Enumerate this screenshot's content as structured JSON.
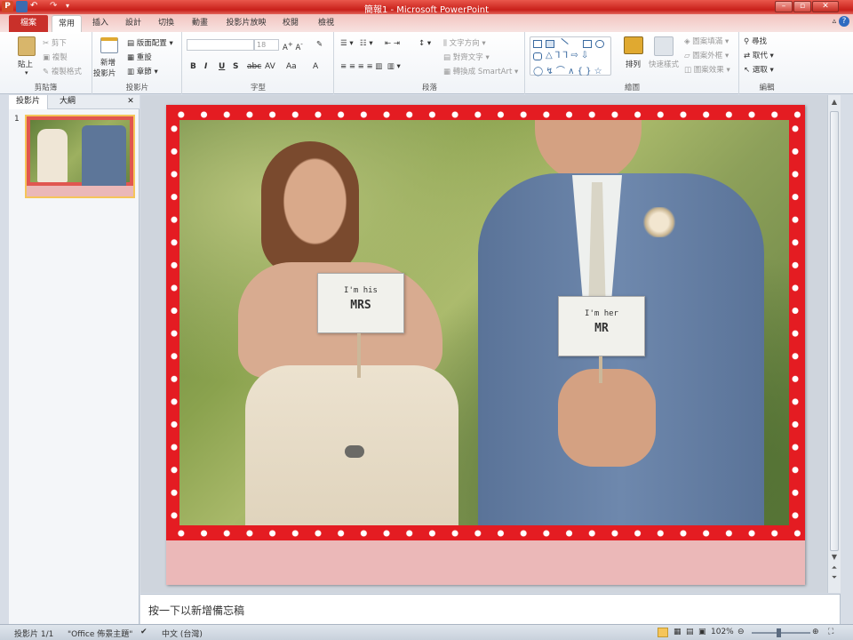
{
  "window": {
    "title": "簡報1 - Microsoft PowerPoint"
  },
  "tabs": [
    "檔案",
    "常用",
    "插入",
    "設計",
    "切換",
    "動畫",
    "投影片放映",
    "校閱",
    "檢視"
  ],
  "ribbon": {
    "clipboard": {
      "name": "剪貼簿",
      "paste": "貼上",
      "cut": "剪下",
      "copy": "複製",
      "format_painter": "複製格式"
    },
    "slides": {
      "name": "投影片",
      "new_slide_1": "新增",
      "new_slide_2": "投影片",
      "layout": "版面配置",
      "reset": "重設",
      "section": "章節"
    },
    "font": {
      "name": "字型",
      "size": "18"
    },
    "paragraph": {
      "name": "段落",
      "text_direction": "文字方向",
      "align_text": "對齊文字",
      "smartart": "轉換成 SmartArt"
    },
    "drawing": {
      "name": "繪圖",
      "arrange": "排列",
      "quick_styles": "快速樣式",
      "shape_fill": "圖案填滿",
      "shape_outline": "圖案外框",
      "shape_effects": "圖案效果"
    },
    "editing": {
      "name": "編輯",
      "find": "尋找",
      "replace": "取代",
      "select": "選取"
    }
  },
  "left_panel": {
    "tabs": [
      "投影片",
      "大綱"
    ],
    "slide_number": "1"
  },
  "slide": {
    "bride_sign_1": "I'm his",
    "bride_sign_2": "MRS",
    "groom_sign_1": "I'm her",
    "groom_sign_2": "MR"
  },
  "notes": {
    "placeholder": "按一下以新增備忘稿"
  },
  "status": {
    "slide_count": "投影片 1/1",
    "theme": "\"Office 佈景主題\"",
    "language": "中文 (台灣)",
    "zoom": "102%"
  },
  "colors": {
    "accent": "#c9302a",
    "frame": "#e41c22",
    "slide_bottom": "#ebb8b8"
  }
}
